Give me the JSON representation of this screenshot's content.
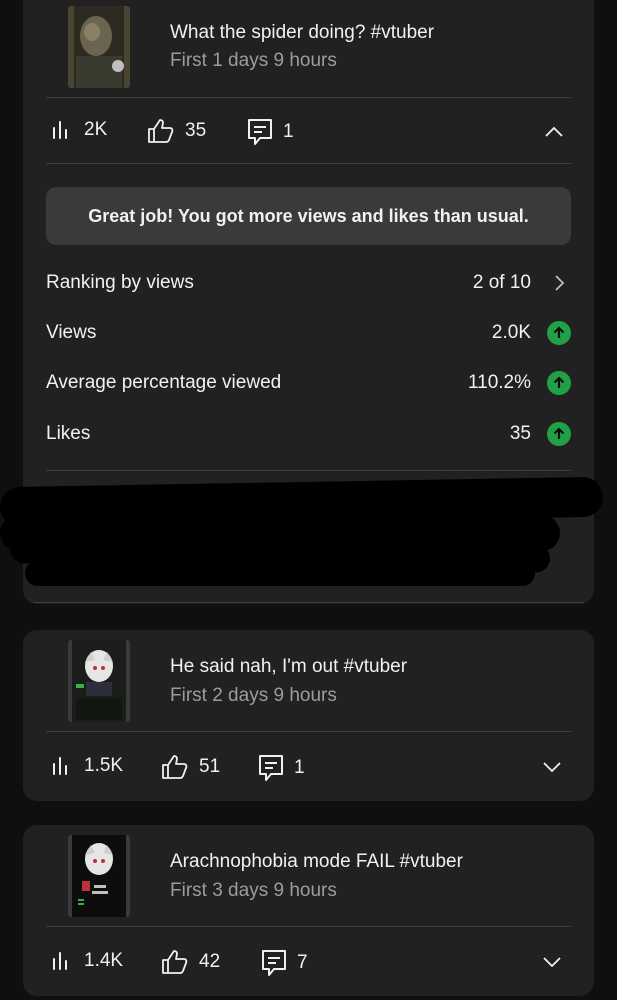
{
  "videos": [
    {
      "title": "What the spider doing? #vtuber",
      "subtitle": "First 1 days 9 hours",
      "views": "2K",
      "likes": "35",
      "comments": "1",
      "expanded": true,
      "insights": {
        "banner": "Great job! You got more views and likes than usual.",
        "rows": [
          {
            "label": "Ranking by views",
            "value": "2 of 10",
            "indicator": "chevron-right"
          },
          {
            "label": "Views",
            "value": "2.0K",
            "indicator": "up-arrow"
          },
          {
            "label": "Average percentage viewed",
            "value": "110.2%",
            "indicator": "up-arrow"
          },
          {
            "label": "Likes",
            "value": "35",
            "indicator": "up-arrow"
          }
        ]
      }
    },
    {
      "title": "He said nah, I'm out #vtuber",
      "subtitle": "First 2 days 9 hours",
      "views": "1.5K",
      "likes": "51",
      "comments": "1",
      "expanded": false
    },
    {
      "title": "Arachnophobia mode FAIL #vtuber",
      "subtitle": "First 3 days 9 hours",
      "views": "1.4K",
      "likes": "42",
      "comments": "7",
      "expanded": false
    }
  ],
  "colors": {
    "background": "#0f0f0f",
    "card": "#212121",
    "banner": "#3a3a3a",
    "positive": "#22a047",
    "secondary_text": "#9c9c9c"
  }
}
